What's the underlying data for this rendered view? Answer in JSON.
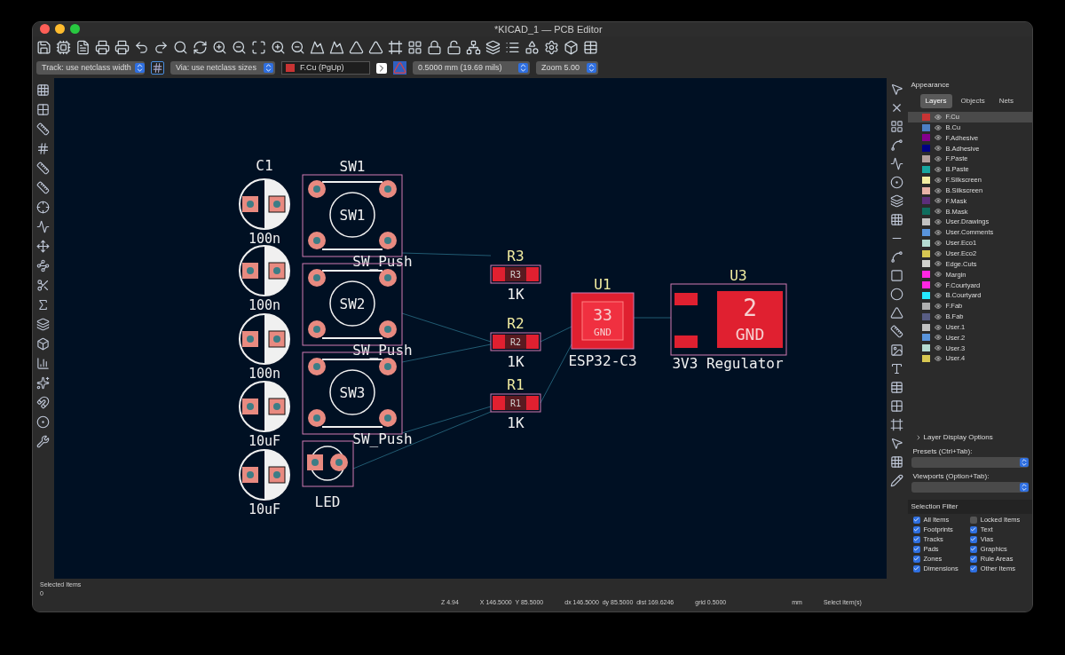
{
  "window": {
    "title": "*KICAD_1 — PCB Editor"
  },
  "options_bar": [
    {
      "kind": "dropdown",
      "value": "Track: use netclass width"
    },
    {
      "kind": "dropdown",
      "value": "Via: use netclass sizes"
    },
    {
      "kind": "layer",
      "value": "F.Cu (PgUp)",
      "color": "#c83434"
    },
    {
      "kind": "dropdown",
      "value": "0.5000 mm (19.69 mils)"
    },
    {
      "kind": "dropdown",
      "value": "Zoom 5.00"
    }
  ],
  "footprints": [
    {
      "kind": "capacitor",
      "ref": "C1",
      "value": "100n"
    },
    {
      "kind": "capacitor",
      "value": "100n"
    },
    {
      "kind": "capacitor",
      "value": "100n"
    },
    {
      "kind": "capacitor",
      "value": "10uF"
    },
    {
      "kind": "capacitor",
      "value": "10uF"
    },
    {
      "kind": "switch",
      "ref": "SW1",
      "label": "SW1",
      "value": "SW_Push"
    },
    {
      "kind": "switch",
      "label": "SW2",
      "value": "SW_Push"
    },
    {
      "kind": "switch",
      "label": "SW3",
      "value": "SW_Push"
    },
    {
      "kind": "led",
      "value": "LED"
    },
    {
      "kind": "resistor",
      "ref": "R3",
      "label": "R3",
      "value": "1K"
    },
    {
      "kind": "resistor",
      "ref": "R2",
      "label": "R2",
      "value": "1K"
    },
    {
      "kind": "resistor",
      "ref": "R1",
      "label": "R1",
      "value": "1K"
    },
    {
      "kind": "ic",
      "ref": "U1",
      "pad_number": "33",
      "pad_net": "GND",
      "value": "ESP32-C3"
    },
    {
      "kind": "regulator",
      "ref": "U3",
      "pad_number": "2",
      "pad_net": "GND",
      "value": "3V3 Regulator"
    }
  ],
  "appearance": {
    "title": "Appearance",
    "tabs": [
      {
        "label": "Layers",
        "selected": true
      },
      {
        "label": "Objects",
        "selected": false
      },
      {
        "label": "Nets",
        "selected": false
      }
    ],
    "layers": [
      {
        "name": "F.Cu",
        "color": "#c83434",
        "selected": true
      },
      {
        "name": "B.Cu",
        "color": "#4d7fc4",
        "selected": false
      },
      {
        "name": "F.Adhesive",
        "color": "#84008e",
        "selected": false
      },
      {
        "name": "B.Adhesive",
        "color": "#000084",
        "selected": false
      },
      {
        "name": "F.Paste",
        "color": "#b4a09e",
        "selected": false
      },
      {
        "name": "B.Paste",
        "color": "#17a6a0",
        "selected": false
      },
      {
        "name": "F.Silkscreen",
        "color": "#f2eda1",
        "selected": false
      },
      {
        "name": "B.Silkscreen",
        "color": "#e8b2a7",
        "selected": false
      },
      {
        "name": "F.Mask",
        "color": "#5c2e7a",
        "selected": false
      },
      {
        "name": "B.Mask",
        "color": "#0f6d5e",
        "selected": false
      },
      {
        "name": "User.Drawings",
        "color": "#c2c2c2",
        "selected": false
      },
      {
        "name": "User.Comments",
        "color": "#5994dc",
        "selected": false
      },
      {
        "name": "User.Eco1",
        "color": "#b4dbd2",
        "selected": false
      },
      {
        "name": "User.Eco2",
        "color": "#d8c852",
        "selected": false
      },
      {
        "name": "Edge.Cuts",
        "color": "#d0d2cd",
        "selected": false
      },
      {
        "name": "Margin",
        "color": "#ff26e2",
        "selected": false
      },
      {
        "name": "F.Courtyard",
        "color": "#ff26e2",
        "selected": false
      },
      {
        "name": "B.Courtyard",
        "color": "#26e9ff",
        "selected": false
      },
      {
        "name": "F.Fab",
        "color": "#afafaf",
        "selected": false
      },
      {
        "name": "B.Fab",
        "color": "#585d84",
        "selected": false
      },
      {
        "name": "User.1",
        "color": "#c2c2c2",
        "selected": false
      },
      {
        "name": "User.2",
        "color": "#5994dc",
        "selected": false
      },
      {
        "name": "User.3",
        "color": "#b4dbd2",
        "selected": false
      },
      {
        "name": "User.4",
        "color": "#d8c852",
        "selected": false
      }
    ],
    "display_options": {
      "label": "Layer Display Options",
      "expanded": false
    },
    "presets": {
      "label": "Presets (Ctrl+Tab):"
    },
    "viewports": {
      "label": "Viewports (Option+Tab):"
    }
  },
  "selection_filter": {
    "title": "Selection Filter",
    "items": [
      {
        "label": "All Items",
        "checked": true
      },
      {
        "label": "Locked Items",
        "checked": false
      },
      {
        "label": "Footprints",
        "checked": true
      },
      {
        "label": "Text",
        "checked": true
      },
      {
        "label": "Tracks",
        "checked": true
      },
      {
        "label": "Vias",
        "checked": true
      },
      {
        "label": "Pads",
        "checked": true
      },
      {
        "label": "Graphics",
        "checked": true
      },
      {
        "label": "Zones",
        "checked": true
      },
      {
        "label": "Rule Areas",
        "checked": true
      },
      {
        "label": "Dimensions",
        "checked": true
      },
      {
        "label": "Other Items",
        "checked": true
      }
    ]
  },
  "status_bar": {
    "selected_label": "Selected Items",
    "selected_count": "0",
    "fields": [
      "Z 4.94",
      "X 146.5000  Y 85.5000",
      "dx 146.5000  dy 85.5000  dist 169.6246",
      "grid 0.5000",
      "mm",
      "Select item(s)"
    ]
  }
}
